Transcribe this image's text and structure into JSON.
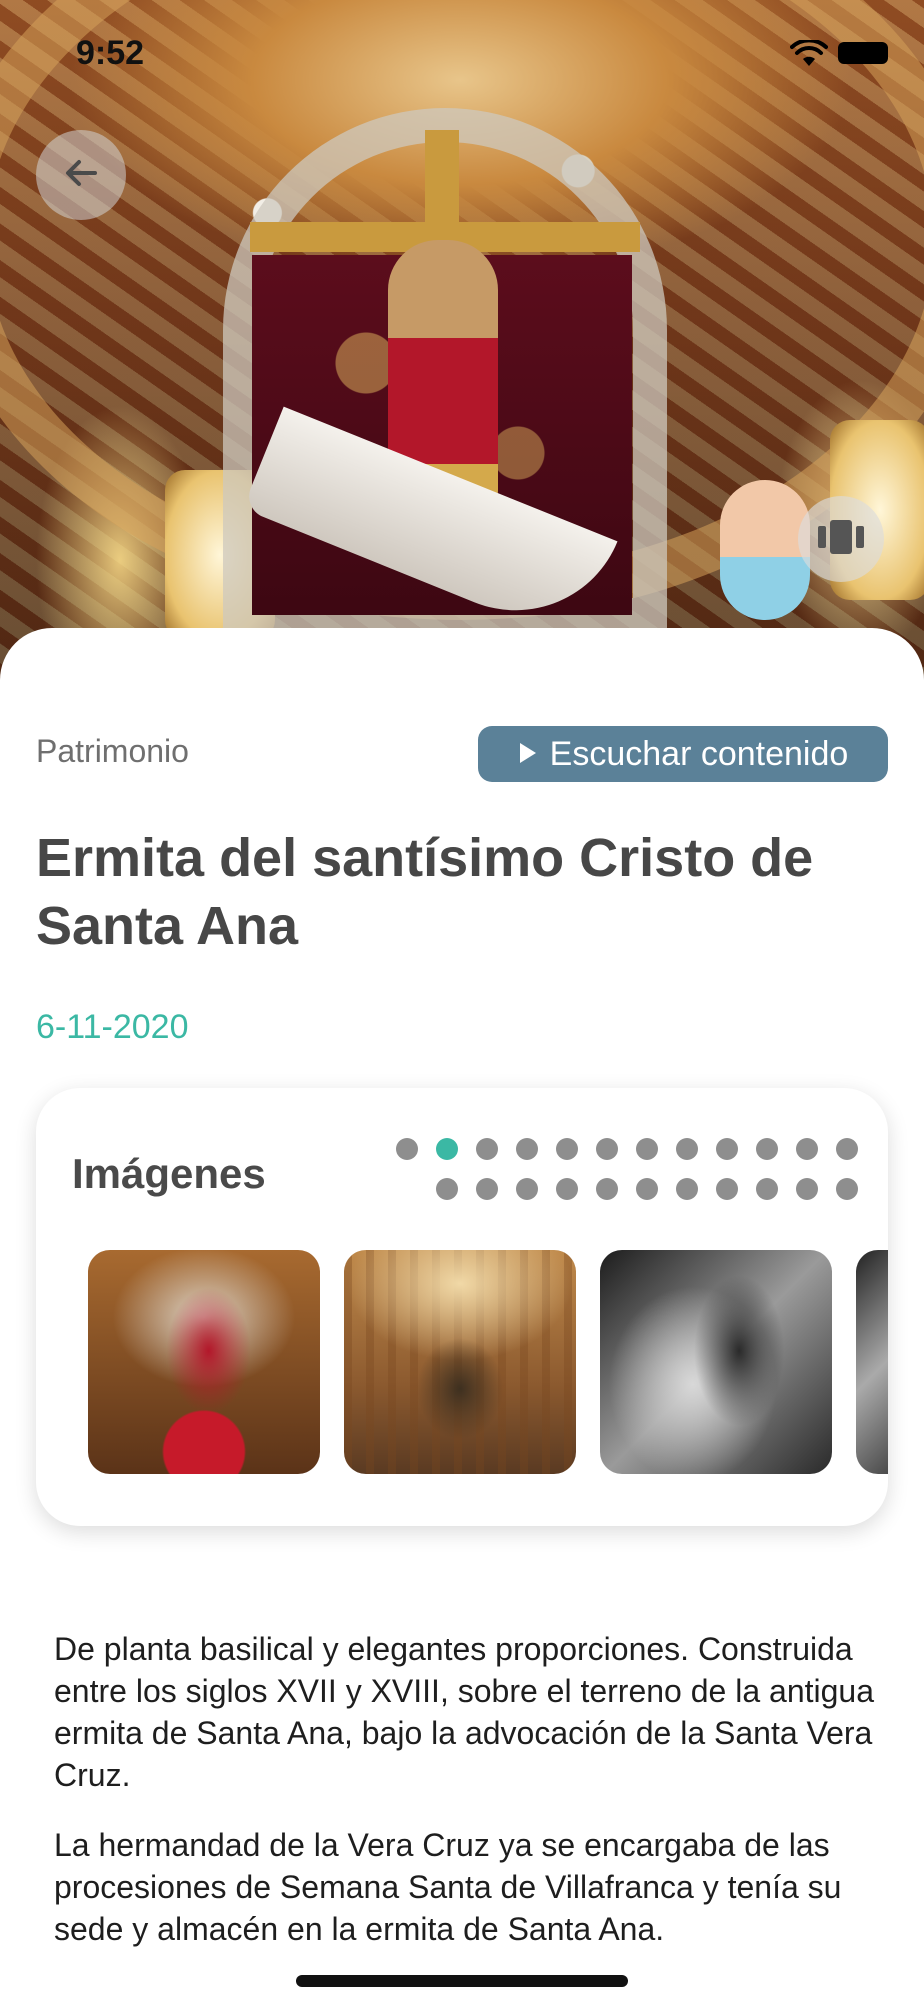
{
  "status_bar": {
    "time": "9:52",
    "icons": [
      "wifi-icon",
      "battery-icon"
    ]
  },
  "hero": {
    "icons": [
      "back-arrow-icon",
      "gallery-icon"
    ]
  },
  "article": {
    "category": "Patrimonio",
    "listen_label": "Escuchar contenido",
    "title": "Ermita del santísimo Cristo de Santa Ana",
    "date": "6-11-2020",
    "paragraphs": [
      "De planta basilical y elegantes proporciones. Construida entre los siglos XVII y XVIII, sobre el terreno de la antigua ermita de Santa Ana, bajo la advocación de la Santa Vera Cruz.",
      "La hermandad de la Vera Cruz ya se encargaba de las procesiones de Semana Santa de Villafranca y tenía su sede y almacén en la ermita de Santa Ana."
    ]
  },
  "images": {
    "title": "Imágenes",
    "total_images": 23,
    "active_index": 1
  },
  "colors": {
    "accent_teal": "#3bb8a4",
    "listen_button": "#5b8198",
    "title_text": "#474747",
    "category_text": "#6f6f6f"
  }
}
